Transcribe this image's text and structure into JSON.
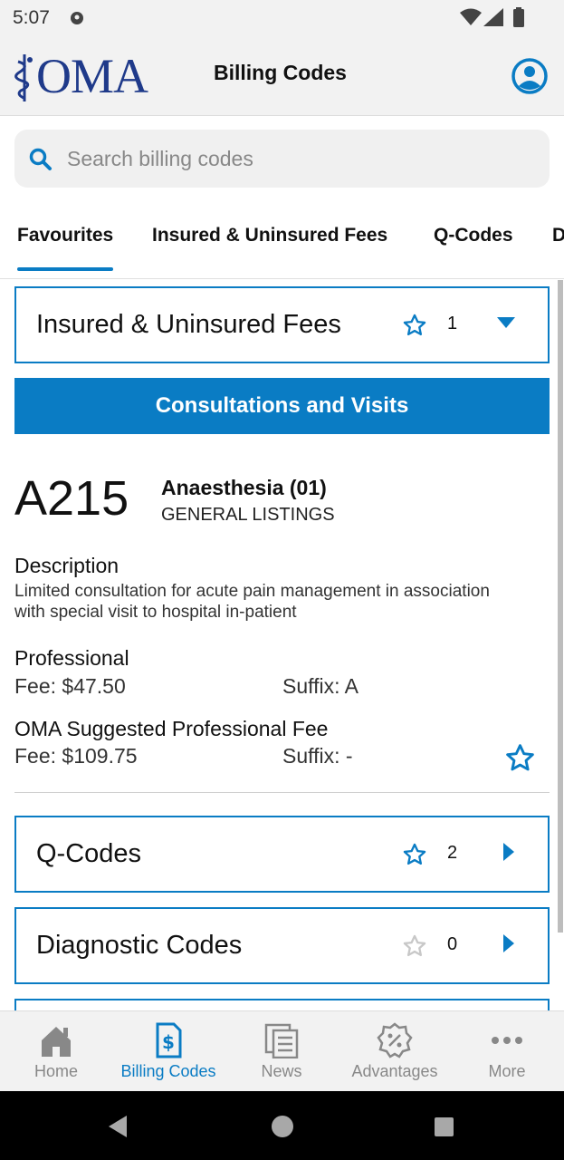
{
  "status_bar": {
    "time": "5:07"
  },
  "header": {
    "logo_text": "OMA",
    "title": "Billing Codes"
  },
  "search": {
    "placeholder": "Search billing codes",
    "value": ""
  },
  "tabs": [
    {
      "label": "Favourites",
      "active": true
    },
    {
      "label": "Insured & Uninsured Fees"
    },
    {
      "label": "Q-Codes"
    },
    {
      "label": "D"
    }
  ],
  "sections": [
    {
      "label": "Insured & Uninsured Fees",
      "count": "1",
      "expanded": true,
      "starred": true
    },
    {
      "label": "Q-Codes",
      "count": "2",
      "expanded": false,
      "starred": true
    },
    {
      "label": "Diagnostic Codes",
      "count": "0",
      "expanded": false,
      "starred": false
    }
  ],
  "category_banner": "Consultations and Visits",
  "billing_item": {
    "code": "A215",
    "specialty": "Anaesthesia (01)",
    "listing": "GENERAL LISTINGS",
    "description_label": "Description",
    "description": "Limited consultation for acute pain management in association with special visit to hospital in-patient",
    "professional_label": "Professional",
    "professional_fee": "Fee: $47.50",
    "professional_suffix": "Suffix: A",
    "suggested_label": "OMA Suggested Professional Fee",
    "suggested_fee": "Fee: $109.75",
    "suggested_suffix": "Suffix: -",
    "favourite": true
  },
  "bottom_nav": [
    {
      "label": "Home",
      "icon": "home-icon"
    },
    {
      "label": "Billing Codes",
      "icon": "billing-codes-icon",
      "active": true
    },
    {
      "label": "News",
      "icon": "news-icon"
    },
    {
      "label": "Advantages",
      "icon": "advantages-icon"
    },
    {
      "label": "More",
      "icon": "more-icon"
    }
  ],
  "colors": {
    "accent": "#0a7cc4",
    "brand": "#1f3a8a",
    "inactive": "#888888"
  }
}
